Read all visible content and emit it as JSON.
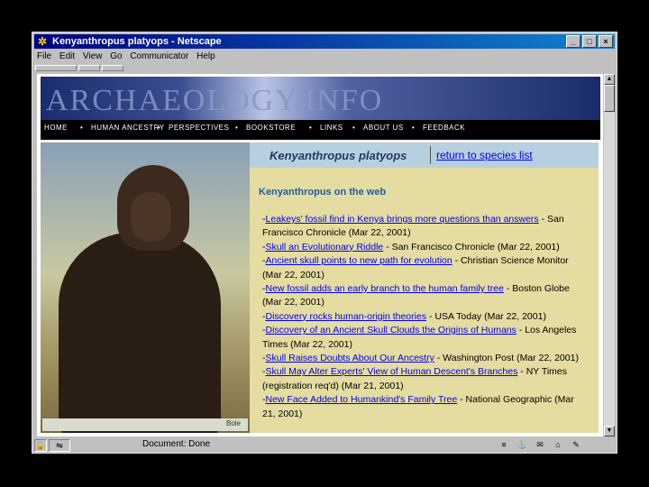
{
  "window": {
    "title": "Kenyanthropus platyops - Netscape",
    "icon": "netscape-icon",
    "buttons": [
      "_",
      "□",
      "×"
    ]
  },
  "menu": [
    "File",
    "Edit",
    "View",
    "Go",
    "Communicator",
    "Help"
  ],
  "site": {
    "logo": "ARCHAEOLOGY.INFO",
    "nav": [
      "HOME",
      "HUMAN ANCESTRY",
      "PERSPECTIVES",
      "BOOKSTORE",
      "LINKS",
      "ABOUT US",
      "FEEDBACK"
    ]
  },
  "page": {
    "species": "Kenyanthropus platyops",
    "return_link": "return to species list",
    "section_title": "Kenyanthropus on the web",
    "photo_caption": "Bole",
    "links": [
      {
        "title": "Leakeys' fossil find in Kenya brings more questions than answers",
        "source": " - San Francisco Chronicle (Mar 22, 2001)"
      },
      {
        "title": "Skull an Evolutionary Riddle",
        "source": " - San Francisco Chronicle (Mar 22, 2001)"
      },
      {
        "title": "Ancient skull points to new path for evolution",
        "source": " - Christian Science Monitor (Mar 22, 2001)"
      },
      {
        "title": "New fossil adds an early branch to the human family tree",
        "source": " - Boston Globe (Mar 22, 2001)"
      },
      {
        "title": "Discovery rocks human-origin theories",
        "source": " - USA Today (Mar 22, 2001)"
      },
      {
        "title": "Discovery of an Ancient Skull Clouds the Origins of Humans",
        "source": " - Los Angeles Times (Mar 22, 2001)"
      },
      {
        "title": "Skull Raises Doubts About Our Ancestry",
        "source": " - Washington Post (Mar 22, 2001)"
      },
      {
        "title": "Skull May Alter Experts' View of Human Descent's Branches",
        "source": " - NY Times (registration req'd) (Mar 21, 2001)"
      },
      {
        "title": "New Face Added to Humankind's Family Tree",
        "source": " - National Geographic (Mar 21, 2001)"
      }
    ]
  },
  "status": {
    "text": "Document: Done"
  }
}
